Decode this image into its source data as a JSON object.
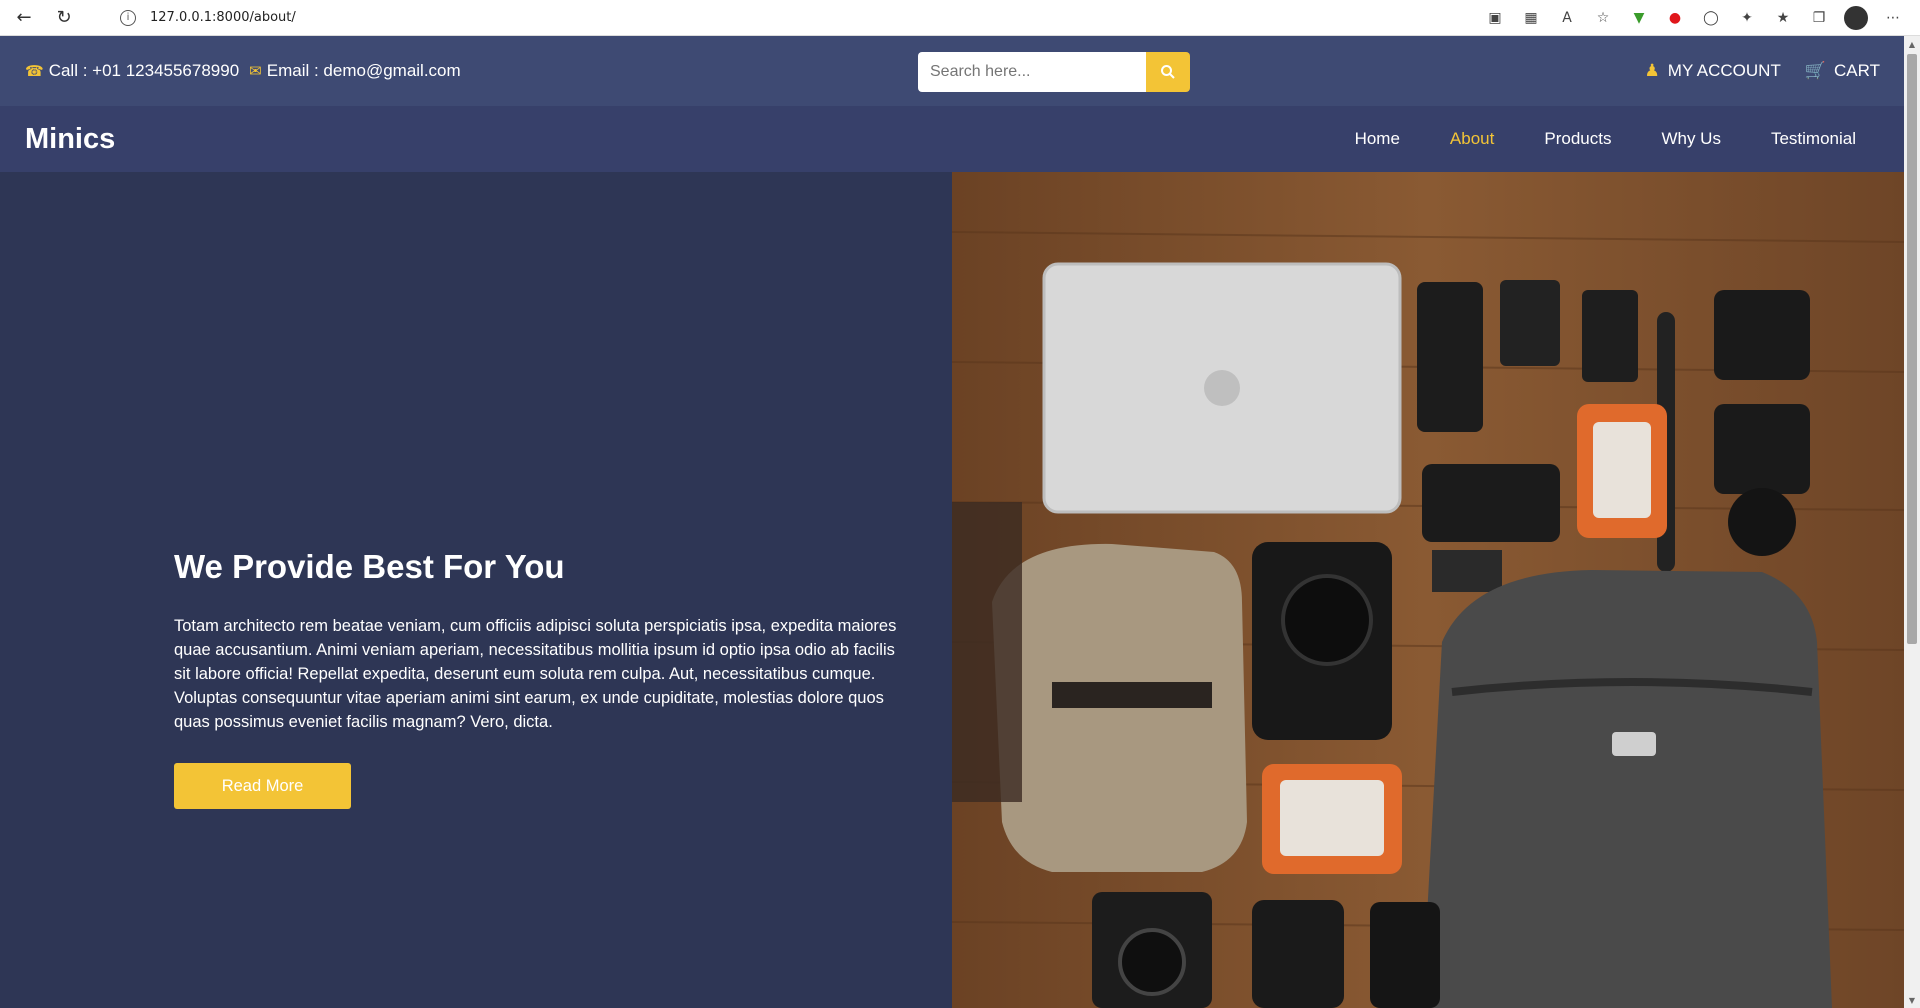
{
  "browser": {
    "back_icon": "back-arrow-icon",
    "reload_icon": "reload-icon",
    "url": "127.0.0.1:8000/about/"
  },
  "topbar": {
    "phone_label": "Call : +01 123455678990",
    "email_label": "Email : demo@gmail.com",
    "search_placeholder": "Search here...",
    "account_label": "MY ACCOUNT",
    "cart_label": "CART"
  },
  "nav": {
    "brand": "Minics",
    "items": [
      {
        "label": "Home"
      },
      {
        "label": "About"
      },
      {
        "label": "Products"
      },
      {
        "label": "Why Us"
      },
      {
        "label": "Testimonial"
      }
    ],
    "active": "About"
  },
  "hero": {
    "title": "We Provide Best For You",
    "text": "Totam architecto rem beatae veniam, cum officiis adipisci soluta perspiciatis ipsa, expedita maiores quae accusantium. Animi veniam aperiam, necessitatibus mollitia ipsum id optio ipsa odio ab facilis sit labore officia! Repellat expedita, deserunt eum soluta rem culpa. Aut, necessitatibus cumque. Voluptas consequuntur vitae aperiam animi sint earum, ex unde cupiditate, molestias dolore quos quas possimus eveniet facilis magnam? Vero, dicta.",
    "button_label": "Read More"
  },
  "colors": {
    "accent": "#f3c436",
    "topbar": "#3e4a73",
    "navbar": "#37406a",
    "hero_bg": "#2e3655"
  }
}
